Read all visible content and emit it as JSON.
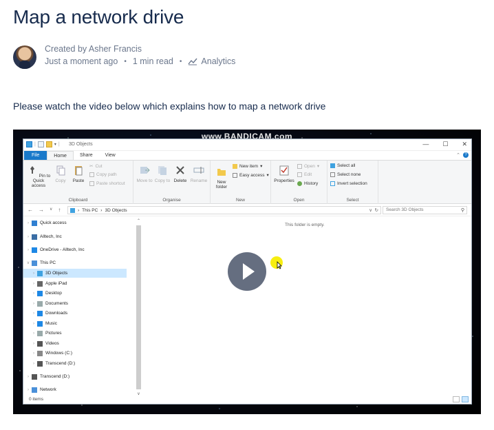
{
  "page": {
    "title": "Map a network drive",
    "created_by": "Created by Asher Francis",
    "time": "Just a moment ago",
    "read_time": "1 min read",
    "analytics": "Analytics",
    "intro": "Please watch the video below which explains how to map a network drive"
  },
  "video": {
    "watermark": "www.BANDICAM.com",
    "explorer": {
      "window_title": "3D Objects",
      "tabs": [
        "File",
        "Home",
        "Share",
        "View"
      ],
      "clipboard": {
        "pin": "Pin to Quick access",
        "copy": "Copy",
        "paste": "Paste",
        "cut": "Cut",
        "copy_path": "Copy path",
        "paste_shortcut": "Paste shortcut",
        "label": "Clipboard"
      },
      "organise": {
        "move_to": "Move to",
        "copy_to": "Copy to",
        "delete": "Delete",
        "rename": "Rename",
        "label": "Organise"
      },
      "new": {
        "new_folder": "New folder",
        "new_item": "New item",
        "easy_access": "Easy access",
        "label": "New"
      },
      "open": {
        "properties": "Properties",
        "open": "Open",
        "edit": "Edit",
        "history": "History",
        "label": "Open"
      },
      "select": {
        "select_all": "Select all",
        "select_none": "Select none",
        "invert": "Invert selection",
        "label": "Select"
      },
      "address": {
        "this_pc": "This PC",
        "current": "3D Objects",
        "search_placeholder": "Search 3D Objects"
      },
      "nav_items": [
        "Quick access",
        "Alltech, Inc",
        "OneDrive - Alltech, Inc",
        "This PC",
        "3D Objects",
        "Apple iPad",
        "Desktop",
        "Documents",
        "Downloads",
        "Music",
        "Pictures",
        "Videos",
        "Windows (C:)",
        "Transcend (D:)",
        "Transcend (D:)",
        "Network"
      ],
      "empty_message": "This folder is empty.",
      "status": "0 items"
    }
  }
}
